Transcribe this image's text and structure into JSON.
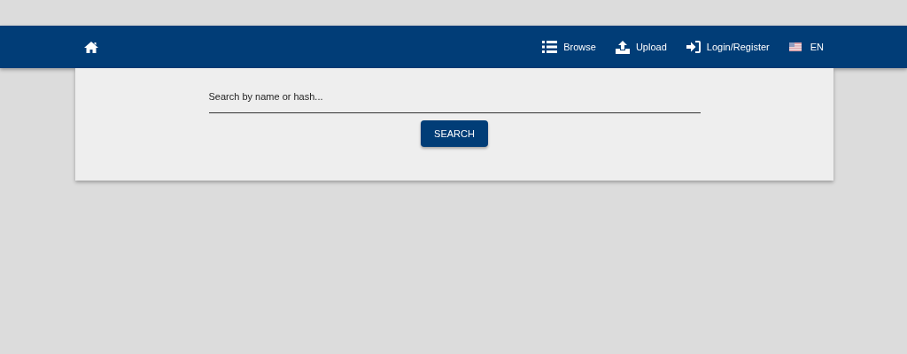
{
  "navbar": {
    "items": [
      {
        "kind": "browse",
        "label": "Browse"
      },
      {
        "kind": "upload",
        "label": "Upload"
      },
      {
        "kind": "login",
        "label": "Login/Register"
      },
      {
        "kind": "language",
        "label": "EN"
      }
    ]
  },
  "search": {
    "placeholder": "Search by name or hash...",
    "button": "SEARCH"
  }
}
